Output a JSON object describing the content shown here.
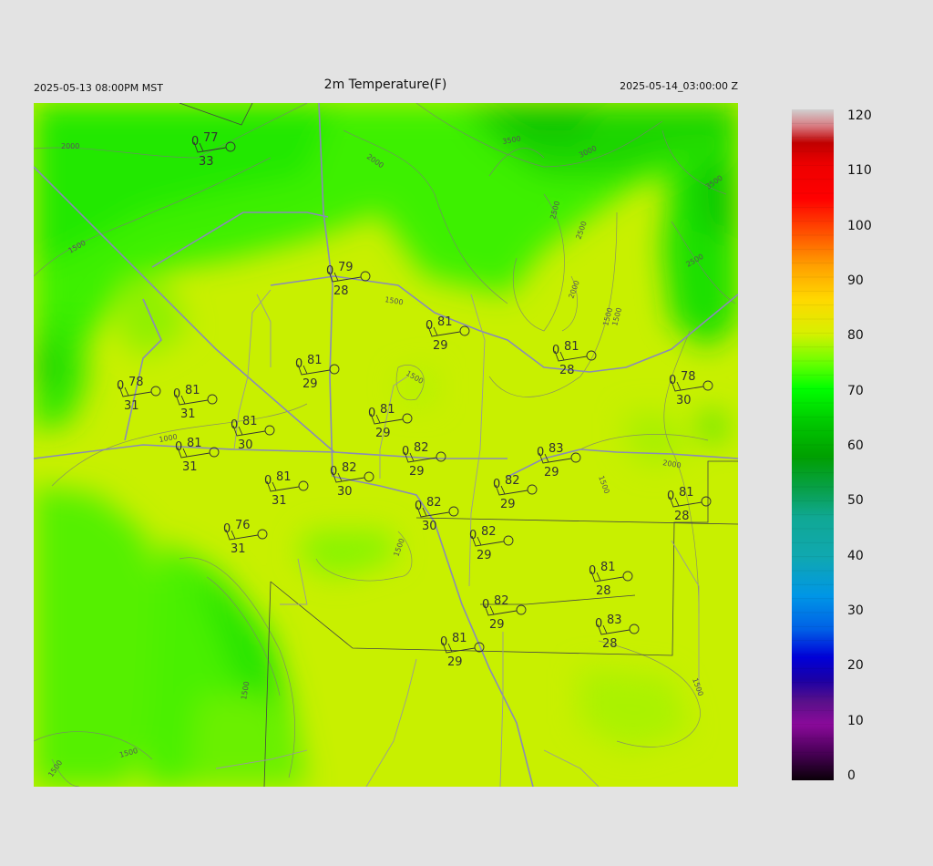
{
  "header": {
    "local_time": "2025-05-13 08:00PM MST",
    "title": "2m Temperature(F)",
    "valid_time": "2025-05-14_03:00:00 Z"
  },
  "colorbar": {
    "ticks": [
      "120",
      "110",
      "100",
      "90",
      "80",
      "70",
      "60",
      "50",
      "40",
      "30",
      "20",
      "10",
      "0"
    ],
    "stops": [
      {
        "v": 0,
        "c": "#0a0008"
      },
      {
        "v": 5,
        "c": "#4a0058"
      },
      {
        "v": 10,
        "c": "#8a0a9a"
      },
      {
        "v": 14,
        "c": "#5a108a"
      },
      {
        "v": 18,
        "c": "#1a00a6"
      },
      {
        "v": 22,
        "c": "#0000d8"
      },
      {
        "v": 27,
        "c": "#0060e6"
      },
      {
        "v": 33,
        "c": "#0096e6"
      },
      {
        "v": 40,
        "c": "#10a8b0"
      },
      {
        "v": 47,
        "c": "#10a894"
      },
      {
        "v": 52,
        "c": "#08a04a"
      },
      {
        "v": 58,
        "c": "#00a000"
      },
      {
        "v": 64,
        "c": "#00c800"
      },
      {
        "v": 70,
        "c": "#00ff00"
      },
      {
        "v": 75,
        "c": "#70ff00"
      },
      {
        "v": 80,
        "c": "#d8f000"
      },
      {
        "v": 86,
        "c": "#ffd800"
      },
      {
        "v": 92,
        "c": "#ffa000"
      },
      {
        "v": 98,
        "c": "#ff5000"
      },
      {
        "v": 104,
        "c": "#ff0000"
      },
      {
        "v": 110,
        "c": "#ee0000"
      },
      {
        "v": 114,
        "c": "#c00000"
      },
      {
        "v": 117,
        "c": "#d87a80"
      },
      {
        "v": 120,
        "c": "#d0d0d0"
      }
    ]
  },
  "map": {
    "background_color": "#c8f000",
    "contour_labels": [
      "2000",
      "2000",
      "1500",
      "1500",
      "1500",
      "1500",
      "1000",
      "1500",
      "1500",
      "1500",
      "1500",
      "1500",
      "2000",
      "2000",
      "2500",
      "3000",
      "3500",
      "3500",
      "2500",
      "2500",
      "1500",
      "1500"
    ],
    "stations": [
      {
        "temp": "77",
        "dew": "33",
        "calm": "0"
      },
      {
        "temp": "79",
        "dew": "28",
        "calm": "0"
      },
      {
        "temp": "81",
        "dew": "29",
        "calm": "0"
      },
      {
        "temp": "81",
        "dew": "28",
        "calm": "0"
      },
      {
        "temp": "78",
        "dew": "31",
        "calm": "0"
      },
      {
        "temp": "81",
        "dew": "31",
        "calm": "0"
      },
      {
        "temp": "81",
        "dew": "29",
        "calm": "0"
      },
      {
        "temp": "78",
        "dew": "30",
        "calm": "0"
      },
      {
        "temp": "81",
        "dew": "29",
        "calm": "0"
      },
      {
        "temp": "81",
        "dew": "30",
        "calm": "0"
      },
      {
        "temp": "81",
        "dew": "31",
        "calm": "0"
      },
      {
        "temp": "82",
        "dew": "29",
        "calm": "0"
      },
      {
        "temp": "83",
        "dew": "29",
        "calm": "0"
      },
      {
        "temp": "81",
        "dew": "31",
        "calm": "0"
      },
      {
        "temp": "82",
        "dew": "30",
        "calm": "0"
      },
      {
        "temp": "82",
        "dew": "29",
        "calm": "0"
      },
      {
        "temp": "81",
        "dew": "28",
        "calm": "0"
      },
      {
        "temp": "82",
        "dew": "30",
        "calm": "0"
      },
      {
        "temp": "76",
        "dew": "31",
        "calm": "0"
      },
      {
        "temp": "82",
        "dew": "29",
        "calm": "0"
      },
      {
        "temp": "81",
        "dew": "28",
        "calm": "0"
      },
      {
        "temp": "82",
        "dew": "29",
        "calm": "0"
      },
      {
        "temp": "83",
        "dew": "28",
        "calm": "0"
      },
      {
        "temp": "81",
        "dew": "29",
        "calm": "0"
      }
    ]
  }
}
